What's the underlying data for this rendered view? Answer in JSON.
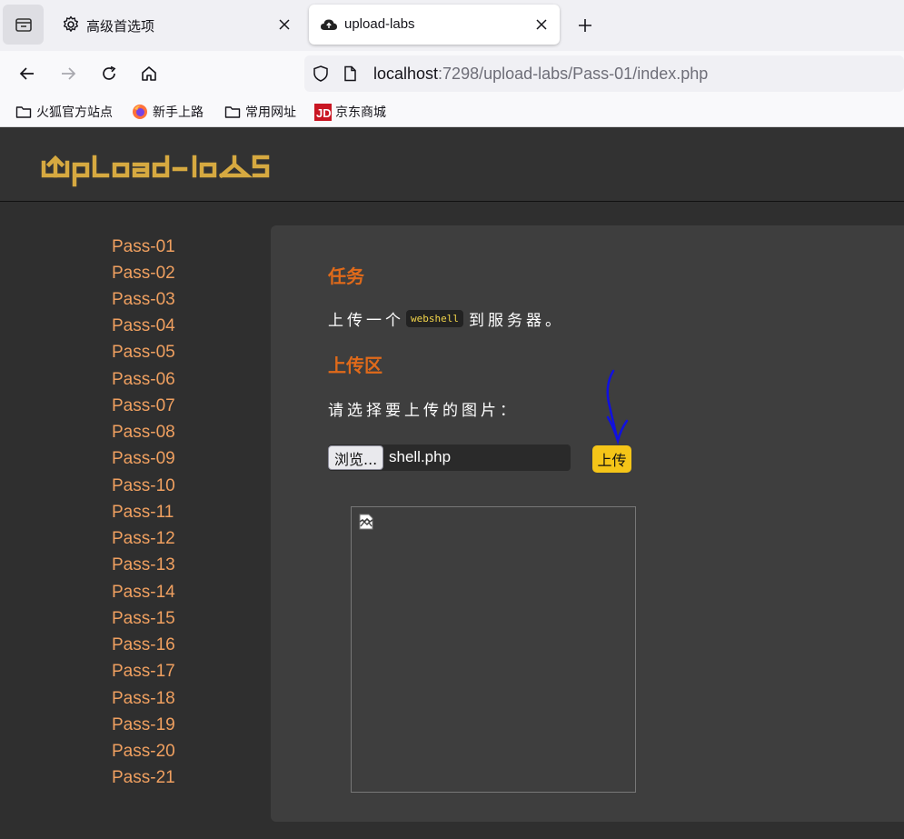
{
  "browser": {
    "tabs": [
      {
        "label": "高级首选项",
        "icon": "gear-icon"
      },
      {
        "label": "upload-labs",
        "icon": "cloud-icon"
      }
    ],
    "url": {
      "host": "localhost",
      "rest": ":7298/upload-labs/Pass-01/index.php"
    },
    "bookmarks": [
      {
        "label": "火狐官方站点",
        "icon": "folder-icon"
      },
      {
        "label": "新手上路",
        "icon": "firefox-icon"
      },
      {
        "label": "常用网址",
        "icon": "folder-icon"
      },
      {
        "label": "京东商城",
        "icon": "jd-icon"
      }
    ]
  },
  "site": {
    "logo_text": "Upload-labs"
  },
  "sidebar": {
    "items": [
      "Pass-01",
      "Pass-02",
      "Pass-03",
      "Pass-04",
      "Pass-05",
      "Pass-06",
      "Pass-07",
      "Pass-08",
      "Pass-09",
      "Pass-10",
      "Pass-11",
      "Pass-12",
      "Pass-13",
      "Pass-14",
      "Pass-15",
      "Pass-16",
      "Pass-17",
      "Pass-18",
      "Pass-19",
      "Pass-20",
      "Pass-21"
    ]
  },
  "content": {
    "task_title": "任务",
    "task_prefix": "上传一个",
    "task_code": "webshell",
    "task_suffix": "到服务器。",
    "upload_title": "上传区",
    "choose_label": "请选择要上传的图片：",
    "browse_label": "浏览...",
    "file_name": "shell.php",
    "upload_button": "上传"
  }
}
